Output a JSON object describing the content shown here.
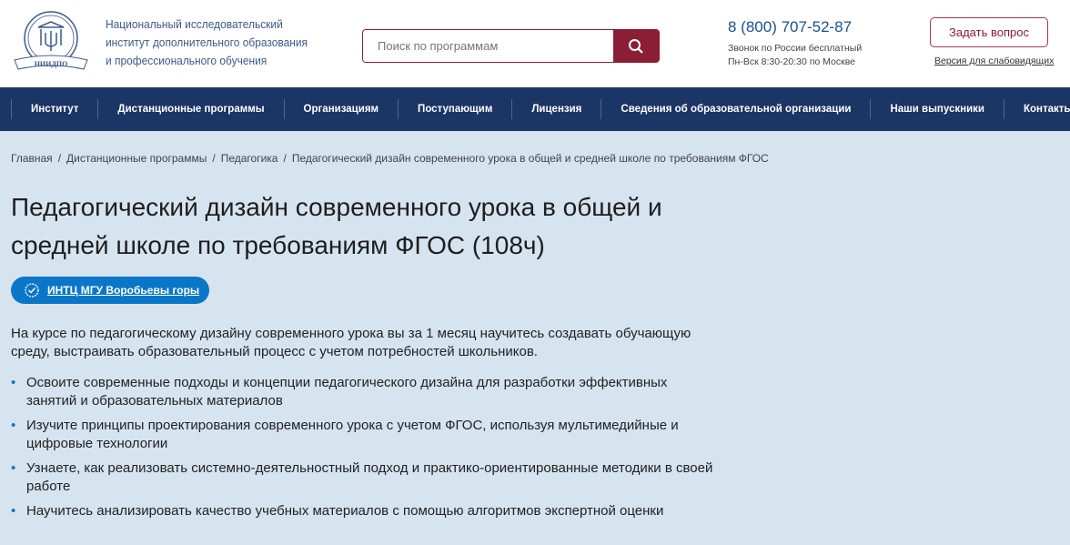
{
  "header": {
    "org_name": [
      "Национальный исследовательский",
      "институт дополнительного образования",
      "и профессионального обучения"
    ],
    "logo_text": "НИИДПО",
    "search_placeholder": "Поиск по программам",
    "phone": "8 (800) 707-52-87",
    "phone_note": "Звонок по России бесплатный",
    "hours": "Пн-Вск 8:30-20:30 по Москве",
    "ask_button": "Задать вопрос",
    "accessibility_link": "Версия для слабовидящих"
  },
  "nav": [
    "Институт",
    "Дистанционные программы",
    "Организациям",
    "Поступающим",
    "Лицензия",
    "Сведения об образовательной организации",
    "Наши выпускники",
    "Контакты"
  ],
  "breadcrumbs": [
    "Главная",
    "Дистанционные программы",
    "Педагогика",
    "Педагогический дизайн современного урока в общей и средней школе по требованиям ФГОС"
  ],
  "title": "Педагогический дизайн современного урока в общей и средней школе по требованиям ФГОС (108ч)",
  "badge": "ИНТЦ МГУ Воробьевы горы",
  "intro": "На курсе по педагогическому дизайну современного урока вы за 1 месяц научитесь создавать обучающую среду, выстраивать образовательный процесс с учетом потребностей школьников.",
  "bullets": [
    "Освоите современные подходы и концепции педагогического дизайна для разработки эффективных занятий и образовательных материалов",
    "Изучите принципы проектирования современного урока с учетом ФГОС, используя мультимедийные и цифровые технологии",
    "Узнаете, как реализовать системно-деятельностный подход и практико-ориентированные методики в своей работе",
    "Научитесь анализировать качество учебных материалов с помощью алгоритмов экспертной оценки"
  ]
}
